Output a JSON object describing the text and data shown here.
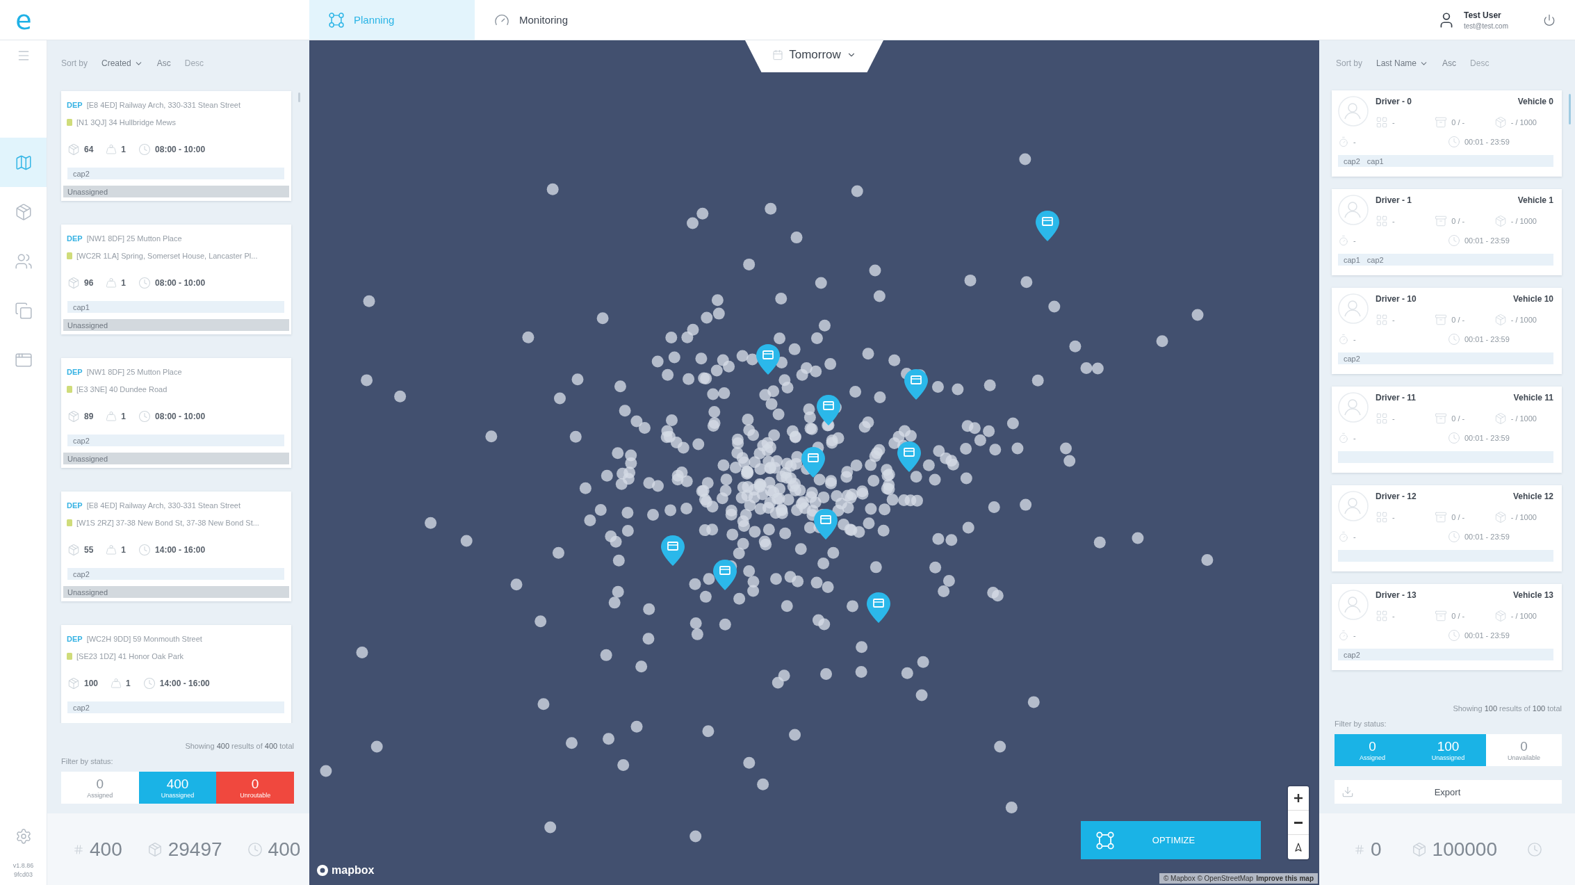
{
  "header": {
    "logo": "e",
    "tabs": [
      {
        "label": "Planning",
        "kind": "planning",
        "selected": true
      },
      {
        "label": "Monitoring",
        "kind": "monitoring",
        "selected": false
      }
    ],
    "user": {
      "name": "Test User",
      "email": "test@test.com"
    }
  },
  "rail": {
    "items": [
      {
        "kind": "map",
        "selected": true
      },
      {
        "kind": "box",
        "selected": false
      },
      {
        "kind": "users",
        "selected": false
      },
      {
        "kind": "copy",
        "selected": false
      },
      {
        "kind": "window",
        "selected": false
      }
    ],
    "version": "v1.8.86",
    "build": "9fcd03"
  },
  "orders_panel": {
    "sort": {
      "label": "Sort by",
      "field": "Created",
      "options": [
        {
          "label": "Asc",
          "selected": true
        },
        {
          "label": "Desc",
          "selected": false
        }
      ]
    },
    "orders": [
      {
        "dep": "DEP",
        "pickup": "[E8 4ED] Railway Arch, 330-331 Stean Street",
        "dropoff": "[N1 3QJ] 34 Hullbridge Mews",
        "size": "64",
        "quantity": "1",
        "window": "08:00 - 10:00",
        "tags": [
          "cap2"
        ],
        "status": "Unassigned"
      },
      {
        "dep": "DEP",
        "pickup": "[NW1 8DF] 25 Mutton Place",
        "dropoff": "[WC2R 1LA] Spring, Somerset House, Lancaster Pl...",
        "size": "96",
        "quantity": "1",
        "window": "08:00 - 10:00",
        "tags": [
          "cap1"
        ],
        "status": "Unassigned"
      },
      {
        "dep": "DEP",
        "pickup": "[NW1 8DF] 25 Mutton Place",
        "dropoff": "[E3 3NE] 40 Dundee Road",
        "size": "89",
        "quantity": "1",
        "window": "08:00 - 10:00",
        "tags": [
          "cap2"
        ],
        "status": "Unassigned"
      },
      {
        "dep": "DEP",
        "pickup": "[E8 4ED] Railway Arch, 330-331 Stean Street",
        "dropoff": "[W1S 2RZ] 37-38 New Bond St, 37-38 New Bond St...",
        "size": "55",
        "quantity": "1",
        "window": "14:00 - 16:00",
        "tags": [
          "cap2"
        ],
        "status": "Unassigned"
      },
      {
        "dep": "DEP",
        "pickup": "[WC2H 9DD] 59 Monmouth Street",
        "dropoff": "[SE23 1DZ] 41 Honor Oak Park",
        "size": "100",
        "quantity": "1",
        "window": "14:00 - 16:00",
        "tags": [
          "cap2"
        ]
      }
    ],
    "summary": "Showing **400** results of **400** total",
    "filter_label": "Filter by status:",
    "filters": [
      {
        "count": "0",
        "label": "Assigned",
        "selected": false
      },
      {
        "count": "400",
        "label": "Unassigned",
        "selected": true,
        "color": "#1ab3e6"
      },
      {
        "count": "0",
        "label": "Unroutable",
        "selected": true,
        "color": "#f0483e"
      }
    ],
    "totals": [
      {
        "kind": "hash",
        "value": "400"
      },
      {
        "kind": "box",
        "value": "29497"
      },
      {
        "kind": "clock",
        "value": "400"
      }
    ]
  },
  "map": {
    "date": "Tomorrow",
    "logo": "mapbox",
    "attribution": "© Mapbox © OpenStreetMap",
    "attribution_link": "Improve this map",
    "optimize": "OPTIMIZE"
  },
  "drivers_panel": {
    "sort": {
      "label": "Sort by",
      "field": "Last Name",
      "options": [
        {
          "label": "Asc",
          "selected": true
        },
        {
          "label": "Desc",
          "selected": false
        }
      ]
    },
    "drivers": [
      {
        "name": "Driver - 0",
        "vehicle": "Vehicle 0",
        "metrics": [
          "-",
          "0 / -",
          "- / 1000"
        ],
        "extra": "-",
        "shift": "00:01 - 23:59",
        "tags": [
          "cap2",
          "cap1"
        ]
      },
      {
        "name": "Driver - 1",
        "vehicle": "Vehicle 1",
        "metrics": [
          "-",
          "0 / -",
          "- / 1000"
        ],
        "extra": "-",
        "shift": "00:01 - 23:59",
        "tags": [
          "cap1",
          "cap2"
        ]
      },
      {
        "name": "Driver - 10",
        "vehicle": "Vehicle 10",
        "metrics": [
          "-",
          "0 / -",
          "- / 1000"
        ],
        "extra": "-",
        "shift": "00:01 - 23:59",
        "tags": [
          "cap2"
        ]
      },
      {
        "name": "Driver - 11",
        "vehicle": "Vehicle 11",
        "metrics": [
          "-",
          "0 / -",
          "- / 1000"
        ],
        "extra": "-",
        "shift": "00:01 - 23:59"
      },
      {
        "name": "Driver - 12",
        "vehicle": "Vehicle 12",
        "metrics": [
          "-",
          "0 / -",
          "- / 1000"
        ],
        "extra": "-",
        "shift": "00:01 - 23:59"
      },
      {
        "name": "Driver - 13",
        "vehicle": "Vehicle 13",
        "metrics": [
          "-",
          "0 / -",
          "- / 1000"
        ],
        "extra": "-",
        "shift": "00:01 - 23:59",
        "tags": [
          "cap2"
        ]
      }
    ],
    "summary": "Showing **100** results of **100** total",
    "filter_label": "Filter by status:",
    "filters": [
      {
        "count": "0",
        "label": "Assigned",
        "selected": true,
        "color": "#1ab3e6"
      },
      {
        "count": "100",
        "label": "Unassigned",
        "selected": true,
        "color": "#1ab3e6"
      },
      {
        "count": "0",
        "label": "Unavailable",
        "selected": false
      }
    ],
    "export": "Export",
    "totals": [
      {
        "kind": "hash",
        "value": "0"
      },
      {
        "kind": "box",
        "value": "100000"
      },
      {
        "kind": "clock"
      }
    ]
  }
}
